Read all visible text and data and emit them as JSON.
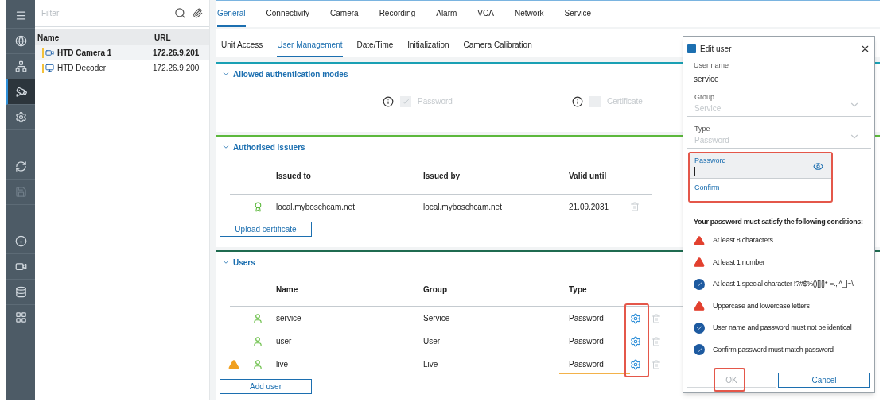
{
  "rail": {
    "items": [
      {
        "selected": false
      },
      {
        "selected": false
      },
      {
        "selected": false
      },
      {
        "selected": true
      },
      {
        "selected": false
      },
      {
        "selected": false
      },
      {
        "selected": false,
        "disabled": true
      },
      {
        "selected": false
      },
      {
        "selected": false
      },
      {
        "selected": false
      },
      {
        "selected": false
      }
    ]
  },
  "tree": {
    "filter_placeholder": "Filter",
    "columns": [
      "Name",
      "URL"
    ],
    "rows": [
      {
        "kind": "camera",
        "name": "HTD Camera 1",
        "url": "172.26.9.201",
        "selected": true
      },
      {
        "kind": "decoder",
        "name": "HTD Decoder",
        "url": "172.26.9.200",
        "selected": false
      }
    ]
  },
  "tabs": [
    {
      "label": "General",
      "selected": true
    },
    {
      "label": "Connectivity",
      "selected": false
    },
    {
      "label": "Camera",
      "selected": false
    },
    {
      "label": "Recording",
      "selected": false
    },
    {
      "label": "Alarm",
      "selected": false
    },
    {
      "label": "VCA",
      "selected": false
    },
    {
      "label": "Network",
      "selected": false
    },
    {
      "label": "Service",
      "selected": false
    }
  ],
  "subtabs": [
    {
      "label": "Unit Access",
      "selected": false
    },
    {
      "label": "User Management",
      "selected": true
    },
    {
      "label": "Date/Time",
      "selected": false
    },
    {
      "label": "Initialization",
      "selected": false
    },
    {
      "label": "Camera Calibration",
      "selected": false
    }
  ],
  "auth_section": {
    "title": "Allowed authentication modes",
    "expanded": true,
    "options": [
      {
        "label": "Password",
        "checked": true,
        "disabled": true
      },
      {
        "label": "Certificate",
        "checked": false,
        "disabled": true
      }
    ]
  },
  "issuers_section": {
    "title": "Authorised issuers",
    "expanded": true,
    "columns": [
      "Issued to",
      "Issued by",
      "Valid until"
    ],
    "rows": [
      {
        "issued_to": "local.myboschcam.net",
        "issued_by": "local.myboschcam.net",
        "valid_until": "21.09.2031"
      }
    ],
    "button": "Upload certificate"
  },
  "users_section": {
    "title": "Users",
    "expanded": true,
    "columns": [
      "Name",
      "Group",
      "Type"
    ],
    "rows": [
      {
        "name": "service",
        "group": "Service",
        "type": "Password",
        "warning": false
      },
      {
        "name": "user",
        "group": "User",
        "type": "Password",
        "warning": false
      },
      {
        "name": "live",
        "group": "Live",
        "type": "Password",
        "warning": true
      }
    ],
    "button": "Add user"
  },
  "dialog": {
    "title": "Edit user",
    "user_name": {
      "label": "User name",
      "value": "service"
    },
    "group": {
      "label": "Group",
      "value": "Service",
      "disabled": true
    },
    "type": {
      "label": "Type",
      "value": "Password",
      "disabled": true
    },
    "password": {
      "label": "Password"
    },
    "confirm": {
      "label": "Confirm"
    },
    "conditions_title": "Your password must satisfy the following conditions:",
    "conditions": [
      {
        "text": "At least 8 characters",
        "met": false
      },
      {
        "text": "At least 1 number",
        "met": false
      },
      {
        "text": "At least 1 special character !?#$%()[]{}*-=.,:^_|~\\",
        "met": true
      },
      {
        "text": "Uppercase and lowercase letters",
        "met": false
      },
      {
        "text": "User name and password must not be identical",
        "met": true
      },
      {
        "text": "Confirm password must match password",
        "met": true
      }
    ],
    "ok": "OK",
    "cancel": "Cancel"
  }
}
